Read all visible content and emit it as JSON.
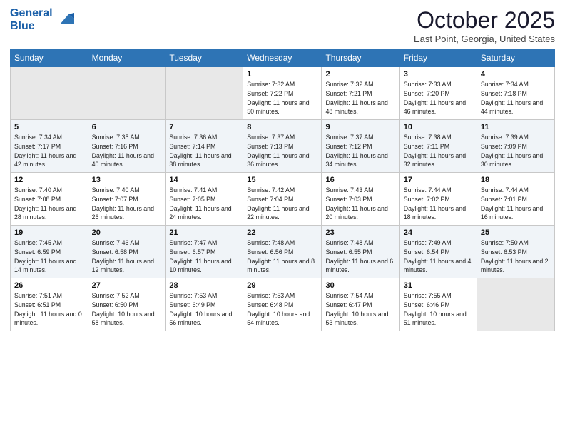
{
  "header": {
    "logo_line1": "General",
    "logo_line2": "Blue",
    "month": "October 2025",
    "location": "East Point, Georgia, United States"
  },
  "days_of_week": [
    "Sunday",
    "Monday",
    "Tuesday",
    "Wednesday",
    "Thursday",
    "Friday",
    "Saturday"
  ],
  "weeks": [
    [
      {
        "day": "",
        "empty": true
      },
      {
        "day": "",
        "empty": true
      },
      {
        "day": "",
        "empty": true
      },
      {
        "day": "1",
        "sunrise": "7:32 AM",
        "sunset": "7:22 PM",
        "daylight": "11 hours and 50 minutes."
      },
      {
        "day": "2",
        "sunrise": "7:32 AM",
        "sunset": "7:21 PM",
        "daylight": "11 hours and 48 minutes."
      },
      {
        "day": "3",
        "sunrise": "7:33 AM",
        "sunset": "7:20 PM",
        "daylight": "11 hours and 46 minutes."
      },
      {
        "day": "4",
        "sunrise": "7:34 AM",
        "sunset": "7:18 PM",
        "daylight": "11 hours and 44 minutes."
      }
    ],
    [
      {
        "day": "5",
        "sunrise": "7:34 AM",
        "sunset": "7:17 PM",
        "daylight": "11 hours and 42 minutes."
      },
      {
        "day": "6",
        "sunrise": "7:35 AM",
        "sunset": "7:16 PM",
        "daylight": "11 hours and 40 minutes."
      },
      {
        "day": "7",
        "sunrise": "7:36 AM",
        "sunset": "7:14 PM",
        "daylight": "11 hours and 38 minutes."
      },
      {
        "day": "8",
        "sunrise": "7:37 AM",
        "sunset": "7:13 PM",
        "daylight": "11 hours and 36 minutes."
      },
      {
        "day": "9",
        "sunrise": "7:37 AM",
        "sunset": "7:12 PM",
        "daylight": "11 hours and 34 minutes."
      },
      {
        "day": "10",
        "sunrise": "7:38 AM",
        "sunset": "7:11 PM",
        "daylight": "11 hours and 32 minutes."
      },
      {
        "day": "11",
        "sunrise": "7:39 AM",
        "sunset": "7:09 PM",
        "daylight": "11 hours and 30 minutes."
      }
    ],
    [
      {
        "day": "12",
        "sunrise": "7:40 AM",
        "sunset": "7:08 PM",
        "daylight": "11 hours and 28 minutes."
      },
      {
        "day": "13",
        "sunrise": "7:40 AM",
        "sunset": "7:07 PM",
        "daylight": "11 hours and 26 minutes."
      },
      {
        "day": "14",
        "sunrise": "7:41 AM",
        "sunset": "7:05 PM",
        "daylight": "11 hours and 24 minutes."
      },
      {
        "day": "15",
        "sunrise": "7:42 AM",
        "sunset": "7:04 PM",
        "daylight": "11 hours and 22 minutes."
      },
      {
        "day": "16",
        "sunrise": "7:43 AM",
        "sunset": "7:03 PM",
        "daylight": "11 hours and 20 minutes."
      },
      {
        "day": "17",
        "sunrise": "7:44 AM",
        "sunset": "7:02 PM",
        "daylight": "11 hours and 18 minutes."
      },
      {
        "day": "18",
        "sunrise": "7:44 AM",
        "sunset": "7:01 PM",
        "daylight": "11 hours and 16 minutes."
      }
    ],
    [
      {
        "day": "19",
        "sunrise": "7:45 AM",
        "sunset": "6:59 PM",
        "daylight": "11 hours and 14 minutes."
      },
      {
        "day": "20",
        "sunrise": "7:46 AM",
        "sunset": "6:58 PM",
        "daylight": "11 hours and 12 minutes."
      },
      {
        "day": "21",
        "sunrise": "7:47 AM",
        "sunset": "6:57 PM",
        "daylight": "11 hours and 10 minutes."
      },
      {
        "day": "22",
        "sunrise": "7:48 AM",
        "sunset": "6:56 PM",
        "daylight": "11 hours and 8 minutes."
      },
      {
        "day": "23",
        "sunrise": "7:48 AM",
        "sunset": "6:55 PM",
        "daylight": "11 hours and 6 minutes."
      },
      {
        "day": "24",
        "sunrise": "7:49 AM",
        "sunset": "6:54 PM",
        "daylight": "11 hours and 4 minutes."
      },
      {
        "day": "25",
        "sunrise": "7:50 AM",
        "sunset": "6:53 PM",
        "daylight": "11 hours and 2 minutes."
      }
    ],
    [
      {
        "day": "26",
        "sunrise": "7:51 AM",
        "sunset": "6:51 PM",
        "daylight": "11 hours and 0 minutes."
      },
      {
        "day": "27",
        "sunrise": "7:52 AM",
        "sunset": "6:50 PM",
        "daylight": "10 hours and 58 minutes."
      },
      {
        "day": "28",
        "sunrise": "7:53 AM",
        "sunset": "6:49 PM",
        "daylight": "10 hours and 56 minutes."
      },
      {
        "day": "29",
        "sunrise": "7:53 AM",
        "sunset": "6:48 PM",
        "daylight": "10 hours and 54 minutes."
      },
      {
        "day": "30",
        "sunrise": "7:54 AM",
        "sunset": "6:47 PM",
        "daylight": "10 hours and 53 minutes."
      },
      {
        "day": "31",
        "sunrise": "7:55 AM",
        "sunset": "6:46 PM",
        "daylight": "10 hours and 51 minutes."
      },
      {
        "day": "",
        "empty": true
      }
    ]
  ]
}
